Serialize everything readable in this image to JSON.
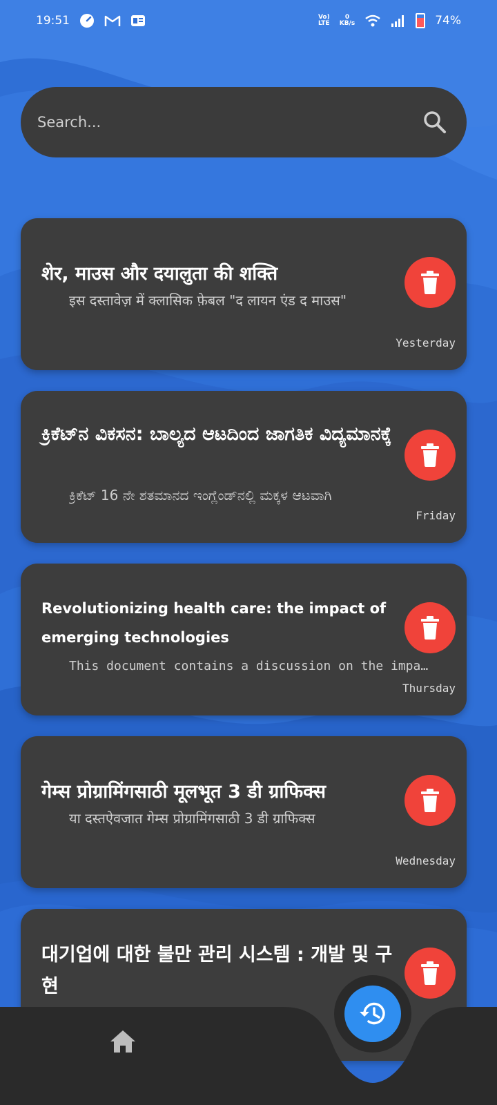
{
  "status_bar": {
    "time": "19:51",
    "net_type_top": "Vo)",
    "net_type_bottom": "LTE",
    "speed_value": "0",
    "speed_unit": "KB/s",
    "battery": "74%"
  },
  "search": {
    "placeholder": "Search..."
  },
  "documents": [
    {
      "title": "शेर, माउस और दयालुता की शक्ति",
      "description": "इस दस्तावेज़ में क्लासिक फ़ेबल \"द लायन एंड द माउस\"",
      "date": "Yesterday"
    },
    {
      "title": "ಕ್ರಿಕೆಟ್‌ನ ವಿಕಸನ: ಬಾಲ್ಯದ ಆಟದಿಂದ ಜಾಗತಿಕ ವಿದ್ಯಮಾನಕ್ಕೆ",
      "description": "ಕ್ರಿಕೆಟ್ 16 ನೇ ಶತಮಾನದ ಇಂಗ್ಲೆಂಡ್‌ನಲ್ಲಿ ಮಕ್ಕಳ ಆಟವಾಗಿ",
      "date": "Friday"
    },
    {
      "title": "Revolutionizing health care: the impact of emerging technologies",
      "description": "This document contains a discussion on the impact",
      "date": "Thursday"
    },
    {
      "title": "गेम्स प्रोग्रामिंगसाठी मूलभूत 3 डी ग्राफिक्स",
      "description": "या दस्तऐवजात गेम्स प्रोग्रामिंगसाठी 3 डी ग्राफिक्स",
      "date": "Wednesday"
    },
    {
      "title": "대기업에 대한 불만 관리 시스템 : 개발 및 구현",
      "description": "",
      "date": ""
    }
  ],
  "colors": {
    "background": "#2f6fd6",
    "card": "#3d3d3d",
    "delete": "#f0433a",
    "fab": "#2f8ef0",
    "nav": "#2a2a2a"
  },
  "icons": {
    "search": "search-icon",
    "delete": "trash-icon",
    "home": "home-icon",
    "history": "history-icon"
  }
}
